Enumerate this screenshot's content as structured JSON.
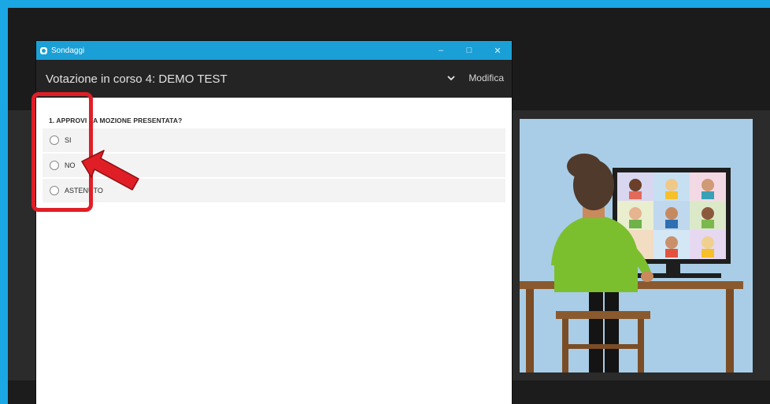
{
  "window": {
    "app_title": "Sondaggi",
    "controls": {
      "minimize": "–",
      "maximize": "□",
      "close": "✕"
    }
  },
  "header": {
    "title": "Votazione in corso 4: DEMO TEST",
    "dropdown_icon": "chevron-down-icon",
    "edit_label": "Modifica"
  },
  "poll": {
    "question": "1. APPROVI LA MOZIONE PRESENTATA?",
    "options": [
      {
        "label": "SI",
        "selected": false
      },
      {
        "label": "NO",
        "selected": false
      },
      {
        "label": "ASTENUTO",
        "selected": false
      }
    ]
  },
  "annotation": {
    "highlight_color": "#e01e26",
    "arrow_color": "#e01e26"
  },
  "colors": {
    "accent": "#1a9fd6",
    "header_bg": "#242424",
    "desktop_bg": "#1f1f1f"
  }
}
